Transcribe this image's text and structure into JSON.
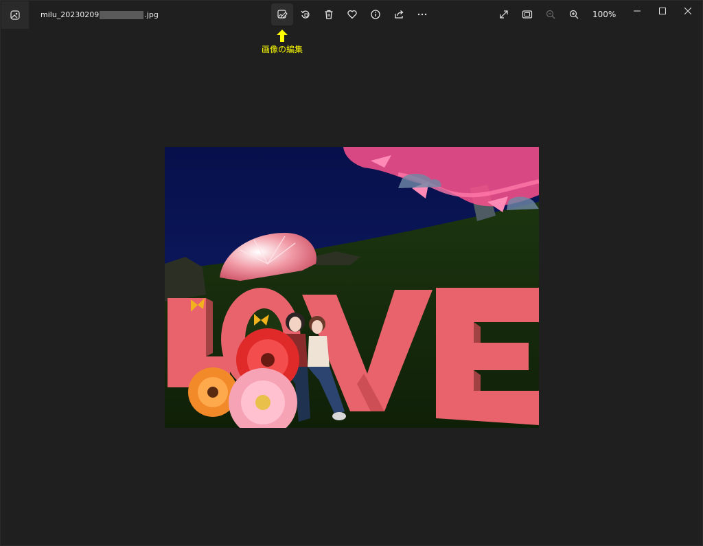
{
  "window": {
    "file_name_prefix": "milu_20230209",
    "file_name_suffix": ".jpg"
  },
  "toolbar": {
    "tools": [
      {
        "name": "edit-image-icon",
        "active": true
      },
      {
        "name": "rotate-icon"
      },
      {
        "name": "delete-icon"
      },
      {
        "name": "favorite-heart-icon"
      },
      {
        "name": "info-icon"
      },
      {
        "name": "share-icon"
      },
      {
        "name": "more-options-icon"
      }
    ],
    "zoom_level": "100%"
  },
  "annotation": {
    "text": "画像の編集",
    "color": "#ffff00"
  },
  "image": {
    "overlay_text": "LOVE"
  },
  "colors": {
    "background": "#1f1f1f",
    "annotation": "#ffff00",
    "love_letters": "#e8636b"
  }
}
